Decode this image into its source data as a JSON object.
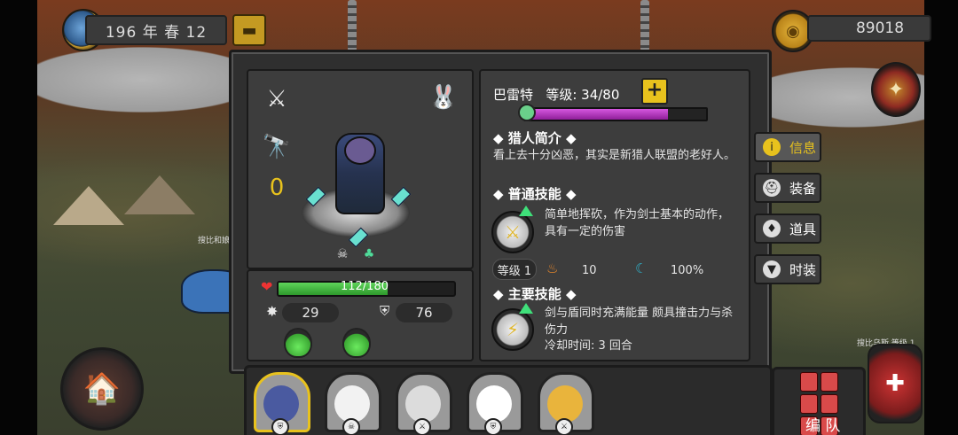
{
  "top_bar": {
    "date": "196 年 春 12",
    "gold": "89018"
  },
  "map_labels": {
    "left": "搜比和娘(等",
    "right": "搜比乌斯 等级 1"
  },
  "hero": {
    "name": "巴雷特",
    "level_label": "等级: 34/80",
    "level": 34,
    "level_max": 80,
    "xp_fraction": 0.79,
    "rank_badge": "0",
    "hp_text": "112/180",
    "hp": 112,
    "hp_max": 180,
    "attack": "29",
    "defense": "76"
  },
  "bio": {
    "title": "猎人简介",
    "text": "看上去十分凶恶，其实是新猎人联盟的老好人。"
  },
  "normal_skill": {
    "title": "普通技能",
    "desc": "简单地挥砍，作为剑士基本的动作，具有一定的伤害",
    "level": "等级 1",
    "cost": "10",
    "rate": "100%"
  },
  "main_skill": {
    "title": "主要技能",
    "desc": "剑与盾同时充满能量 颇具撞击力与杀伤力",
    "cooldown": "冷却时间: 3 回合"
  },
  "tabs": [
    {
      "label": "信息",
      "icon": "info-icon",
      "active": true
    },
    {
      "label": "装备",
      "icon": "helmet-icon",
      "active": false
    },
    {
      "label": "道具",
      "icon": "bag-icon",
      "active": false
    },
    {
      "label": "时装",
      "icon": "shirt-icon",
      "active": false
    }
  ],
  "bottom": {
    "team_label": "编 队"
  },
  "colors": {
    "hp": "#3fbf3a",
    "xp": "#b63ac0",
    "accent": "#e8c21d",
    "panel": "#3d3d3d"
  }
}
